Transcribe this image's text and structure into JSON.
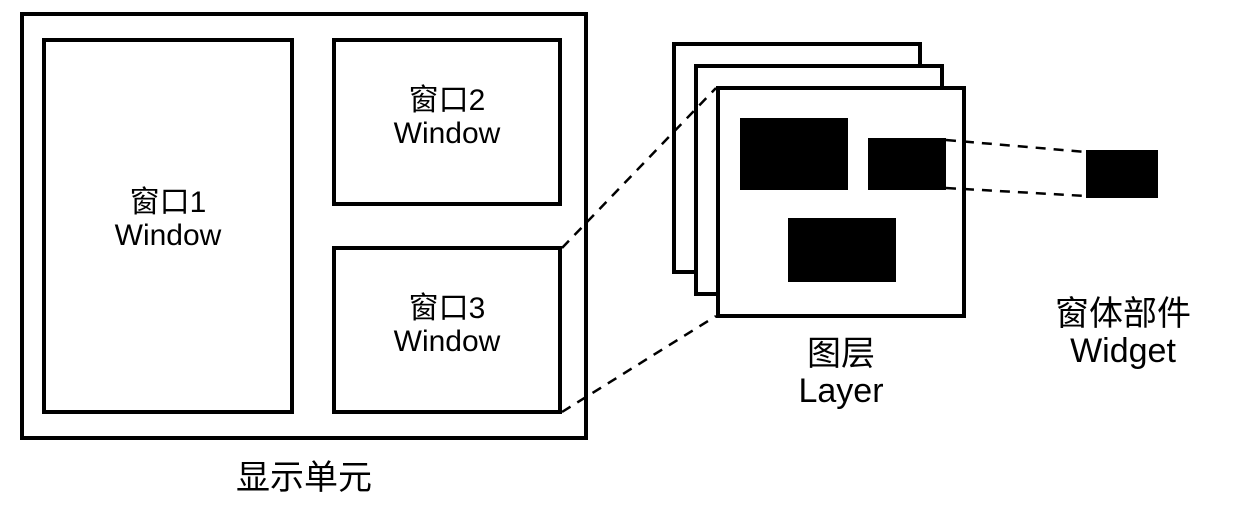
{
  "display_unit": {
    "caption": "显示单元",
    "windows": [
      {
        "cn": "窗口1",
        "en": "Window"
      },
      {
        "cn": "窗口2",
        "en": "Window"
      },
      {
        "cn": "窗口3",
        "en": "Window"
      }
    ]
  },
  "layer": {
    "caption_cn": "图层",
    "caption_en": "Layer"
  },
  "widget": {
    "caption_cn": "窗体部件",
    "caption_en": "Widget"
  }
}
